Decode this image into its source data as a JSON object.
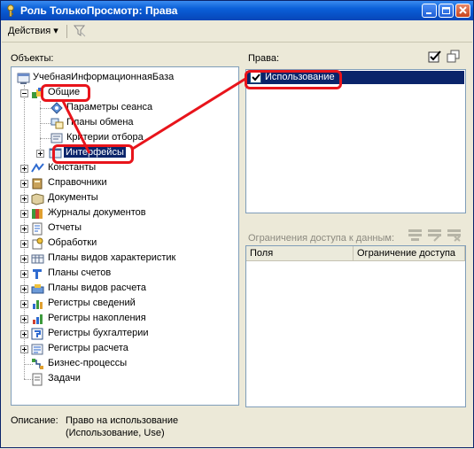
{
  "window": {
    "title": "Роль ТолькоПросмотр: Права"
  },
  "toolbar": {
    "actions_label": "Действия",
    "actions_arrow": "▾"
  },
  "objects_label": "Объекты:",
  "rights_label": "Права:",
  "restrictions_label": "Ограничения доступа к данным:",
  "tree": {
    "root": "УчебнаяИнформационнаяБаза",
    "common": "Общие",
    "session_params": "Параметры сеанса",
    "exchange_plans": "Планы обмена",
    "filter_criteria": "Критерии отбора",
    "interfaces": "Интерфейсы",
    "constants": "Константы",
    "catalogs": "Справочники",
    "documents": "Документы",
    "doc_journals": "Журналы документов",
    "reports": "Отчеты",
    "data_processors": "Обработки",
    "chart_char_types": "Планы видов характеристик",
    "chart_accounts": "Планы счетов",
    "chart_calc_types": "Планы видов расчета",
    "info_registers": "Регистры сведений",
    "accum_registers": "Регистры накопления",
    "account_registers": "Регистры бухгалтерии",
    "calc_registers": "Регистры расчета",
    "business_processes": "Бизнес-процессы",
    "tasks": "Задачи"
  },
  "rights": {
    "items": [
      {
        "label": "Использование",
        "checked": true
      }
    ]
  },
  "restrictions_grid": {
    "columns": [
      "Поля",
      "Ограничение доступа"
    ]
  },
  "description": {
    "label": "Описание:",
    "line1": "Право на использование",
    "line2": "(Использование, Use)"
  },
  "colors": {
    "selection": "#0a246a",
    "annotation": "#e8141b",
    "titlebar": "#0a5fd8"
  }
}
